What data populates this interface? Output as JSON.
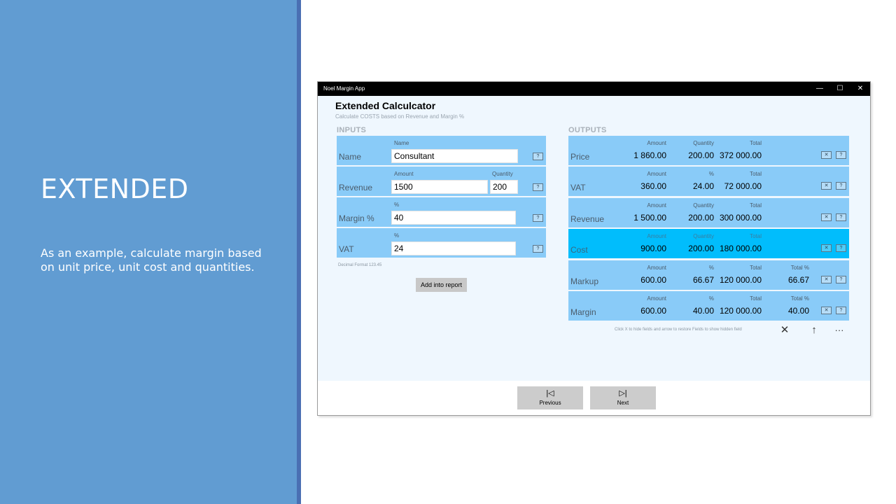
{
  "slide": {
    "title": "EXTENDED",
    "description": "As an example, calculate margin based on unit price, unit cost and quantities."
  },
  "app": {
    "name": "Noel Margin App",
    "window_controls": {
      "minimize": "—",
      "maximize": "☐",
      "close": "✕"
    },
    "page_title": "Extended Calculcator",
    "page_subtitle": "Calculate COSTS based on Revenue and Margin %",
    "inputs_heading": "INPUTS",
    "outputs_heading": "OUTPUTS",
    "help_label": "?",
    "hide_label": "✕",
    "inputs": {
      "name": {
        "label": "Name",
        "caption": "Name",
        "value": "Consultant"
      },
      "revenue": {
        "label": "Revenue",
        "amount_caption": "Amount",
        "amount_value": "1500",
        "quantity_caption": "Quantity",
        "quantity_value": "200"
      },
      "margin": {
        "label": "Margin %",
        "caption": "%",
        "value": "40"
      },
      "vat": {
        "label": "VAT",
        "caption": "%",
        "value": "24"
      }
    },
    "decimal_format": "Decimal Format 123.45",
    "add_report_label": "Add into report",
    "outputs": [
      {
        "label": "Price",
        "c1": "Amount",
        "v1": "1 860.00",
        "c2": "Quantity",
        "v2": "200.00",
        "c3": "Total",
        "v3": "372 000.00",
        "c4": "",
        "v4": ""
      },
      {
        "label": "VAT",
        "c1": "Amount",
        "v1": "360.00",
        "c2": "%",
        "v2": "24.00",
        "c3": "Total",
        "v3": "72 000.00",
        "c4": "",
        "v4": ""
      },
      {
        "label": "Revenue",
        "c1": "Amount",
        "v1": "1 500.00",
        "c2": "Quantity",
        "v2": "200.00",
        "c3": "Total",
        "v3": "300 000.00",
        "c4": "",
        "v4": ""
      },
      {
        "label": "Cost",
        "c1": "Amount",
        "v1": "900.00",
        "c2": "Quantity",
        "v2": "200.00",
        "c3": "Total",
        "v3": "180 000.00",
        "c4": "",
        "v4": ""
      },
      {
        "label": "Markup",
        "c1": "Amount",
        "v1": "600.00",
        "c2": "%",
        "v2": "66.67",
        "c3": "Total",
        "v3": "120 000.00",
        "c4": "Total %",
        "v4": "66.67"
      },
      {
        "label": "Margin",
        "c1": "Amount",
        "v1": "600.00",
        "c2": "%",
        "v2": "40.00",
        "c3": "Total",
        "v3": "120 000.00",
        "c4": "Total %",
        "v4": "40.00"
      }
    ],
    "hint": "Click X to hide fields and arrow to restore Fields to show hidden field",
    "commands": {
      "hide": "✕",
      "restore": "↑",
      "more": "···"
    },
    "nav": {
      "previous_icon": "|◁",
      "previous_label": "Previous",
      "next_icon": "▷|",
      "next_label": "Next"
    }
  },
  "colors": {
    "slide_panel": "#619cd2",
    "accent_bar": "#4a6fb3",
    "row_bg": "#89cbf8",
    "row_highlight": "#01bdfc",
    "app_bg": "#eff7fe"
  }
}
